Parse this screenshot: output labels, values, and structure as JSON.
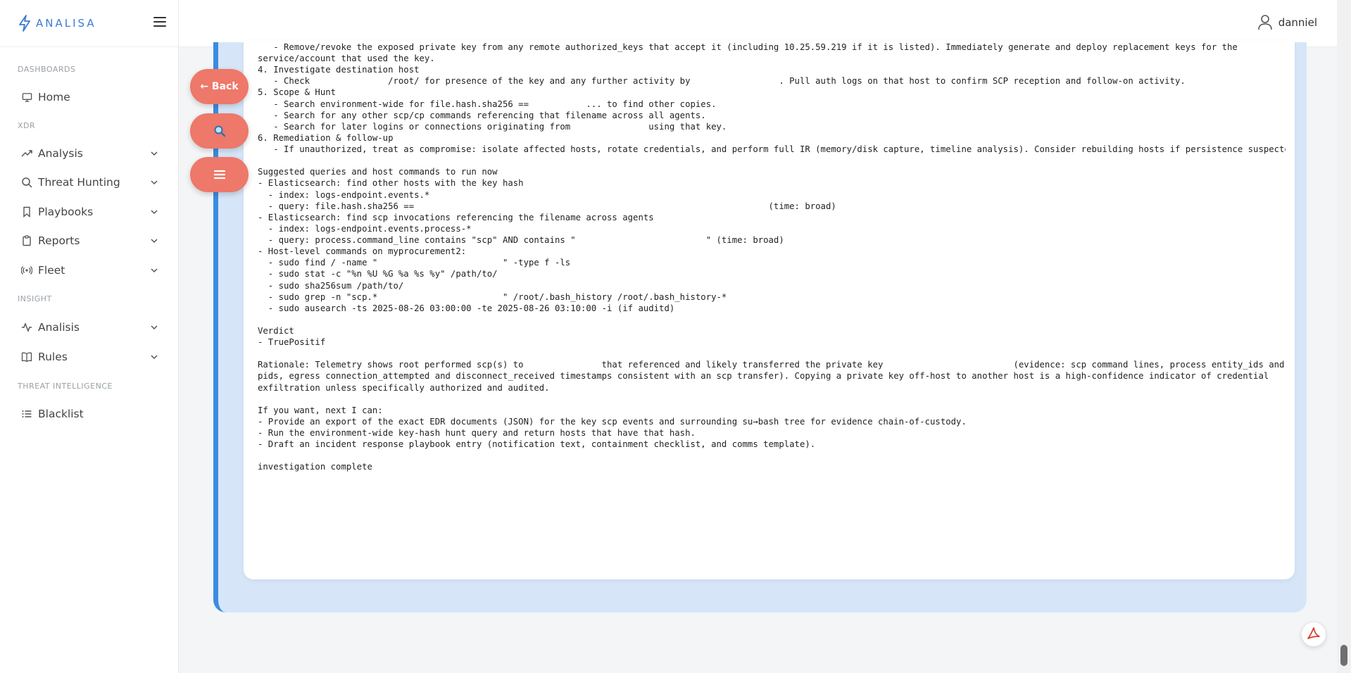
{
  "brand": {
    "name": "ANALISA"
  },
  "sidebar": {
    "sections": [
      {
        "title": "DASHBOARDS"
      },
      {
        "title": "XDR"
      },
      {
        "title": "INSIGHT"
      },
      {
        "title": "THREAT INTELLIGENCE"
      }
    ],
    "items": [
      {
        "label": "Home",
        "icon": "monitor-icon"
      },
      {
        "label": "Analysis",
        "icon": "trend-icon"
      },
      {
        "label": "Threat Hunting",
        "icon": "search-icon"
      },
      {
        "label": "Playbooks",
        "icon": "bookmark-icon"
      },
      {
        "label": "Reports",
        "icon": "clipboard-icon"
      },
      {
        "label": "Fleet",
        "icon": "broadcast-icon"
      },
      {
        "label": "Analisis",
        "icon": "activity-icon"
      },
      {
        "label": "Rules",
        "icon": "book-icon"
      },
      {
        "label": "Blacklist",
        "icon": "list-icon"
      }
    ]
  },
  "header": {
    "username": "danniel"
  },
  "actions": {
    "back_label": "← Back"
  },
  "report_lines": [
    "   - Remove/revoke the exposed private key from any remote authorized_keys that accept it (including 10.25.59.219 if it is listed). Immediately generate and deploy replacement keys for the",
    "service/account that used the key.",
    "4. Investigate destination host",
    "   - Check               /root/ for presence of the key and any further activity by                 . Pull auth logs on that host to confirm SCP reception and follow-on activity.",
    "5. Scope & Hunt",
    "   - Search environment-wide for file.hash.sha256 ==           ... to find other copies.",
    "   - Search for any other scp/cp commands referencing that filename across all agents.",
    "   - Search for later logins or connections originating from               using that key.",
    "6. Remediation & follow-up",
    "   - If unauthorized, treat as compromise: isolate affected hosts, rotate credentials, and perform full IR (memory/disk capture, timeline analysis). Consider rebuilding hosts if persistence suspected.",
    "",
    "Suggested queries and host commands to run now",
    "- Elasticsearch: find other hosts with the key hash",
    "  - index: logs-endpoint.events.*",
    "  - query: file.hash.sha256 ==                                                                    (time: broad)",
    "- Elasticsearch: find scp invocations referencing the filename across agents",
    "  - index: logs-endpoint.events.process-*",
    "  - query: process.command_line contains \"scp\" AND contains \"                         \" (time: broad)",
    "- Host-level commands on myprocurement2:",
    "  - sudo find / -name \"                        \" -type f -ls",
    "  - sudo stat -c \"%n %U %G %a %s %y\" /path/to/",
    "  - sudo sha256sum /path/to/",
    "  - sudo grep -n \"scp.*                        \" /root/.bash_history /root/.bash_history-*",
    "  - sudo ausearch -ts 2025-08-26 03:00:00 -te 2025-08-26 03:10:00 -i (if auditd)",
    "",
    "Verdict",
    "- TruePositif",
    "",
    "Rationale: Telemetry shows root performed scp(s) to               that referenced and likely transferred the private key                         (evidence: scp command lines, process entity_ids and",
    "pids, egress connection_attempted and disconnect_received timestamps consistent with an scp transfer). Copying a private key off-host to another host is a high-confidence indicator of credential",
    "exfiltration unless specifically authorized and audited.",
    "",
    "If you want, next I can:",
    "- Provide an export of the exact EDR documents (JSON) for the key scp events and surrounding su→bash tree for evidence chain-of-custody.",
    "- Run the environment-wide key-hash hunt query and return hosts that have that hash.",
    "- Draft an incident response playbook entry (notification text, containment checklist, and comms template).",
    "",
    "investigation complete"
  ],
  "colors": {
    "accent": "#3b8ce0",
    "action": "#ee7869",
    "panel_bg": "#d6e6f8",
    "brand": "#3a7bd5"
  }
}
